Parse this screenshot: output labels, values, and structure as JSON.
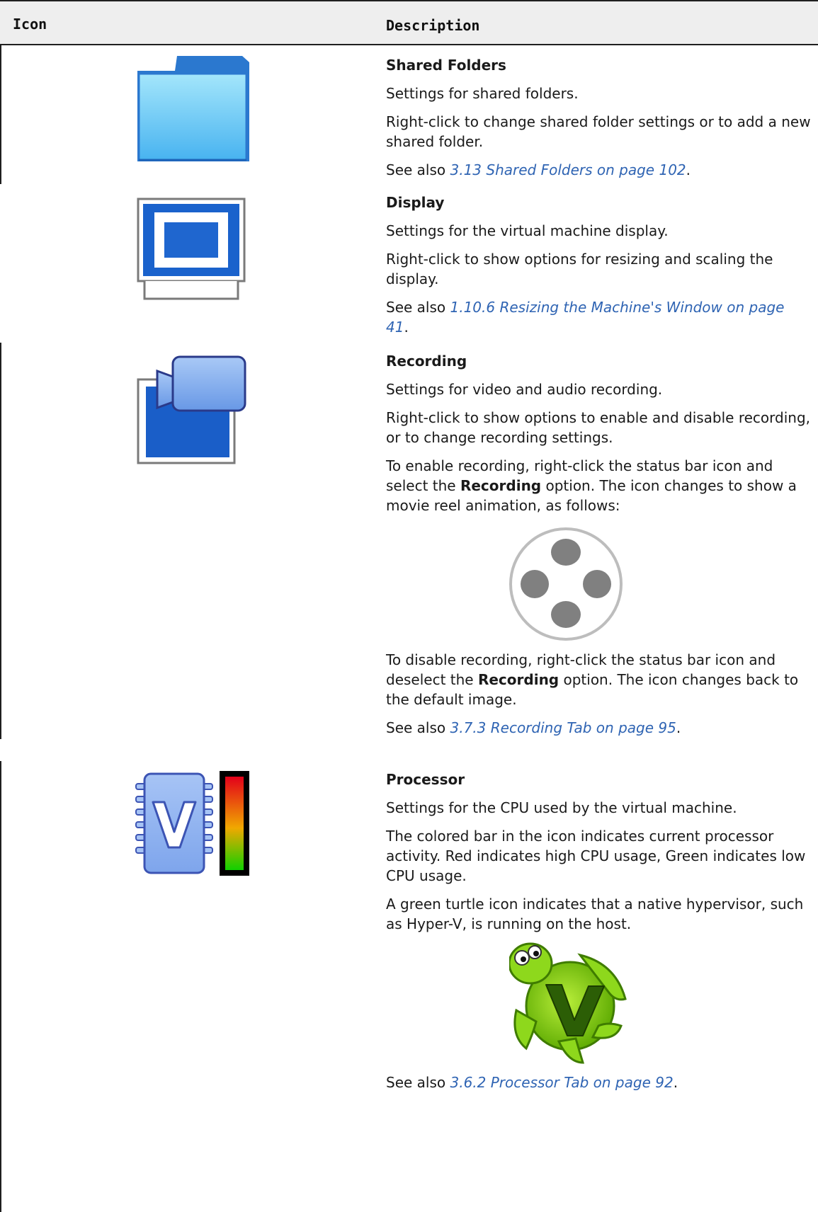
{
  "header": {
    "icon_col": "Icon",
    "description_col": "Description"
  },
  "rows": [
    {
      "title": "Shared Folders",
      "icon": "shared-folder-icon",
      "p1": "Settings for shared folders.",
      "p2": "Right-click to change shared folder settings or to add a new shared folder.",
      "see_also_prefix": "See also ",
      "link": "3.13 Shared Folders on page 102",
      "suffix": "."
    },
    {
      "title": "Display",
      "icon": "display-icon",
      "p1": "Settings for the virtual machine display.",
      "p2": "Right-click to show options for resizing and scaling the display.",
      "see_also_prefix": "See also ",
      "link": "1.10.6 Resizing the Machine's Window on page 41",
      "suffix": "."
    },
    {
      "title": "Recording",
      "icon": "video-camera-icon",
      "p1": "Settings for video and audio recording.",
      "p2": "Right-click to show options to enable and disable recording, or to change recording settings.",
      "p3_a": "To enable recording, right-click the status bar icon and select the ",
      "p3_b": "Recording",
      "p3_c": " option. The icon changes to show a movie reel animation, as follows:",
      "inline_icon": "movie-reel-icon",
      "p4_a": "To disable recording, right-click the status bar icon and deselect the ",
      "p4_b": "Recording",
      "p4_c": " option. The icon changes back to the default image.",
      "see_also_prefix": "See also ",
      "link": "3.7.3 Recording Tab on page 95",
      "suffix": "."
    },
    {
      "title": "Processor",
      "icon": "processor-chip-icon",
      "p1": "Settings for the CPU used by the virtual machine.",
      "p2": "The colored bar in the icon indicates current processor activity. Red indicates high CPU usage, Green indicates low CPU usage.",
      "p3": "A green turtle icon indicates that a native hypervisor, such as Hyper-V, is running on the host.",
      "inline_icon": "green-turtle-icon",
      "see_also_prefix": "See also ",
      "link": "3.6.2 Processor Tab on page 92",
      "suffix": "."
    }
  ]
}
